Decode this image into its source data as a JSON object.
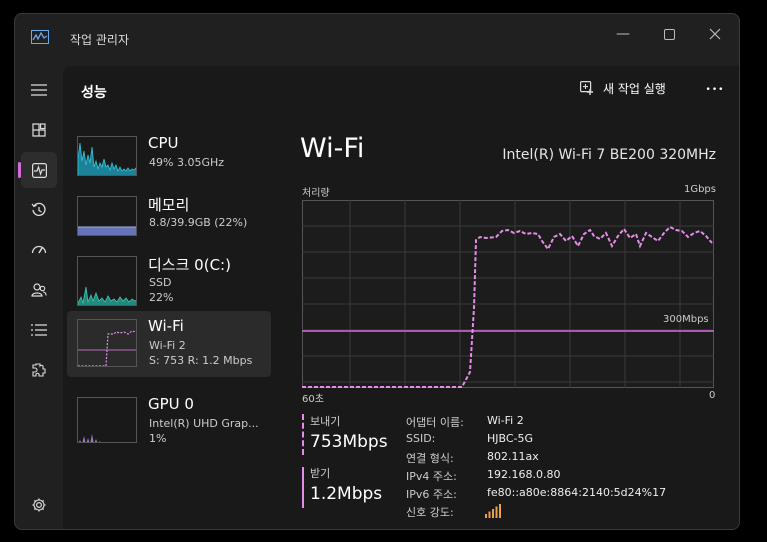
{
  "window": {
    "title": "작업 관리자"
  },
  "page": {
    "title": "성능"
  },
  "toolbar": {
    "new_task_label": "새 작업 실행",
    "more_label": "•••"
  },
  "tiles": [
    {
      "name": "CPU",
      "line1": "49% 3.05GHz",
      "line2": ""
    },
    {
      "name": "메모리",
      "line1": "8.8/39.9GB (22%)",
      "line2": ""
    },
    {
      "name": "디스크 0(C:)",
      "line1": "SSD",
      "line2": "22%"
    },
    {
      "name": "Wi-Fi",
      "line1": "Wi-Fi 2",
      "line2": "S: 753 R: 1.2 Mbps"
    },
    {
      "name": "GPU 0",
      "line1": "Intel(R) UHD Grap...",
      "line2": "1%"
    }
  ],
  "detail": {
    "title": "Wi-Fi",
    "adapter_name": "Intel(R) Wi-Fi 7 BE200 320MHz",
    "throughput_label": "처리량",
    "max_label": "1Gbps",
    "mid_label": "300Mbps",
    "time_label": "60초",
    "zero_label": "0"
  },
  "stats": {
    "send_label": "보내기",
    "send_value": "753Mbps",
    "recv_label": "받기",
    "recv_value": "1.2Mbps"
  },
  "props": [
    {
      "key": "어댑터 이름:",
      "value": "Wi-Fi 2"
    },
    {
      "key": "SSID:",
      "value": "HJBC-5G"
    },
    {
      "key": "연결 형식:",
      "value": "802.11ax"
    },
    {
      "key": "IPv4 주소:",
      "value": "192.168.0.80"
    },
    {
      "key": "IPv6 주소:",
      "value": "fe80::a80e:8864:2140:5d24%17"
    },
    {
      "key": "신호 강도:",
      "value": ""
    }
  ],
  "signal_strength_bars": 5,
  "colors": {
    "accent": "#d56bd9",
    "graph_line": "#e58ce8",
    "cpu": "#1fa5c2",
    "memory": "#7b8ae0",
    "disk": "#27a596",
    "gpu": "#a98ae4",
    "signal": "#e8a14a"
  },
  "icons": {
    "app": "task-manager-icon",
    "menu": "hamburger-icon",
    "processes": "processes-icon",
    "performance": "performance-icon",
    "history": "app-history-icon",
    "startup": "startup-apps-icon",
    "users": "users-icon",
    "details": "details-icon",
    "services": "services-icon",
    "settings": "gear-icon"
  }
}
